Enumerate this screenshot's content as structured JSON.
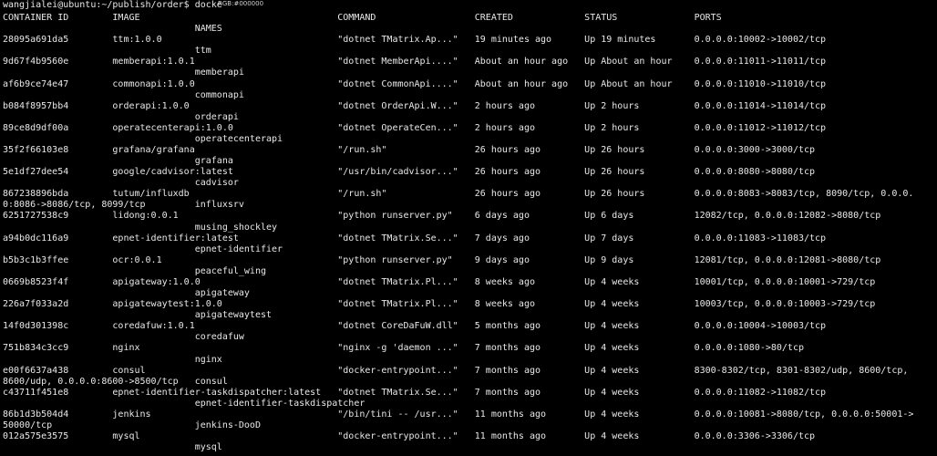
{
  "prompt": "wangjialei@ubuntu:~/publish/order$ docke",
  "pixel_tooltip": "RGB:#000000",
  "headers": [
    "CONTAINER ID",
    "IMAGE",
    "COMMAND",
    "CREATED",
    "STATUS",
    "PORTS",
    "NAMES"
  ],
  "rows": [
    {
      "id": "28095a691da5",
      "image": "ttm:1.0.0",
      "command": "\"dotnet TMatrix.Ap...\"",
      "created": "19 minutes ago",
      "status": "Up 19 minutes",
      "ports": "0.0.0.0:10002->10002/tcp",
      "ports_cont": "",
      "name": "ttm"
    },
    {
      "id": "9d67f4b9560e",
      "image": "memberapi:1.0.1",
      "command": "\"dotnet MemberApi....\"",
      "created": "About an hour ago",
      "status": "Up About an hour",
      "ports": "0.0.0.0:11011->11011/tcp",
      "ports_cont": "",
      "name": "memberapi"
    },
    {
      "id": "af6b9ce74e47",
      "image": "commonapi:1.0.0",
      "command": "\"dotnet CommonApi....\"",
      "created": "About an hour ago",
      "status": "Up About an hour",
      "ports": "0.0.0.0:11010->11010/tcp",
      "ports_cont": "",
      "name": "commonapi"
    },
    {
      "id": "b084f8957bb4",
      "image": "orderapi:1.0.0",
      "command": "\"dotnet OrderApi.W...\"",
      "created": "2 hours ago",
      "status": "Up 2 hours",
      "ports": "0.0.0.0:11014->11014/tcp",
      "ports_cont": "",
      "name": "orderapi"
    },
    {
      "id": "89ce8d9df00a",
      "image": "operatecenterapi:1.0.0",
      "command": "\"dotnet OperateCen...\"",
      "created": "2 hours ago",
      "status": "Up 2 hours",
      "ports": "0.0.0.0:11012->11012/tcp",
      "ports_cont": "",
      "name": "operatecenterapi"
    },
    {
      "id": "35f2f66103e8",
      "image": "grafana/grafana",
      "command": "\"/run.sh\"",
      "created": "26 hours ago",
      "status": "Up 26 hours",
      "ports": "0.0.0.0:3000->3000/tcp",
      "ports_cont": "",
      "name": "grafana"
    },
    {
      "id": "5e1df27dee54",
      "image": "google/cadvisor:latest",
      "command": "\"/usr/bin/cadvisor...\"",
      "created": "26 hours ago",
      "status": "Up 26 hours",
      "ports": "0.0.0.0:8080->8080/tcp",
      "ports_cont": "",
      "name": "cadvisor"
    },
    {
      "id": "867238896bda",
      "image": "tutum/influxdb",
      "command": "\"/run.sh\"",
      "created": "26 hours ago",
      "status": "Up 26 hours",
      "ports": "0.0.0.0:8083->8083/tcp, 8090/tcp, 0.0.0.",
      "ports_cont": "0:8086->8086/tcp, 8099/tcp",
      "name": "influxsrv"
    },
    {
      "id": "6251727538c9",
      "image": "lidong:0.0.1",
      "command": "\"python runserver.py\"",
      "created": "6 days ago",
      "status": "Up 6 days",
      "ports": "12082/tcp, 0.0.0.0:12082->8080/tcp",
      "ports_cont": "",
      "name": "musing_shockley"
    },
    {
      "id": "a94b0dc116a9",
      "image": "epnet-identifier:latest",
      "command": "\"dotnet TMatrix.Se...\"",
      "created": "7 days ago",
      "status": "Up 7 days",
      "ports": "0.0.0.0:11083->11083/tcp",
      "ports_cont": "",
      "name": "epnet-identifier"
    },
    {
      "id": "b5b3c1b3ffee",
      "image": "ocr:0.0.1",
      "command": "\"python runserver.py\"",
      "created": "9 days ago",
      "status": "Up 9 days",
      "ports": "12081/tcp, 0.0.0.0:12081->8080/tcp",
      "ports_cont": "",
      "name": "peaceful_wing"
    },
    {
      "id": "0669b8523f4f",
      "image": "apigateway:1.0.0",
      "command": "\"dotnet TMatrix.Pl...\"",
      "created": "8 weeks ago",
      "status": "Up 4 weeks",
      "ports": "10001/tcp, 0.0.0.0:10001->729/tcp",
      "ports_cont": "",
      "name": "apigateway"
    },
    {
      "id": "226a7f033a2d",
      "image": "apigatewaytest:1.0.0",
      "command": "\"dotnet TMatrix.Pl...\"",
      "created": "8 weeks ago",
      "status": "Up 4 weeks",
      "ports": "10003/tcp, 0.0.0.0:10003->729/tcp",
      "ports_cont": "",
      "name": "apigatewaytest"
    },
    {
      "id": "14f0d301398c",
      "image": "coredafuw:1.0.1",
      "command": "\"dotnet CoreDaFuW.dll\"",
      "created": "5 months ago",
      "status": "Up 4 weeks",
      "ports": "0.0.0.0:10004->10003/tcp",
      "ports_cont": "",
      "name": "coredafuw"
    },
    {
      "id": "751b834c3cc9",
      "image": "nginx",
      "command": "\"nginx -g 'daemon ...\"",
      "created": "7 months ago",
      "status": "Up 4 weeks",
      "ports": "0.0.0.0:1080->80/tcp",
      "ports_cont": "",
      "name": "nginx"
    },
    {
      "id": "e00f6637a438",
      "image": "consul",
      "command": "\"docker-entrypoint...\"",
      "created": "7 months ago",
      "status": "Up 4 weeks",
      "ports": "8300-8302/tcp, 8301-8302/udp, 8600/tcp,",
      "ports_cont": "8600/udp, 0.0.0.0:8600->8500/tcp",
      "name": "consul"
    },
    {
      "id": "c43711f451e8",
      "image": "epnet-identifier-taskdispatcher:latest",
      "command": "\"dotnet TMatrix.Se...\"",
      "created": "7 months ago",
      "status": "Up 4 weeks",
      "ports": "0.0.0.0:11082->11082/tcp",
      "ports_cont": "",
      "name": "epnet-identifier-taskdispatcher"
    },
    {
      "id": "86b1d3b504d4",
      "image": "jenkins",
      "command": "\"/bin/tini -- /usr...\"",
      "created": "11 months ago",
      "status": "Up 4 weeks",
      "ports": "0.0.0.0:10081->8080/tcp, 0.0.0.0:50001->",
      "ports_cont": "50000/tcp",
      "name": "jenkins-DooD"
    },
    {
      "id": "012a575e3575",
      "image": "mysql",
      "command": "\"docker-entrypoint...\"",
      "created": "11 months ago",
      "status": "Up 4 weeks",
      "ports": "0.0.0.0:3306->3306/tcp",
      "ports_cont": "",
      "name": "mysql"
    }
  ]
}
